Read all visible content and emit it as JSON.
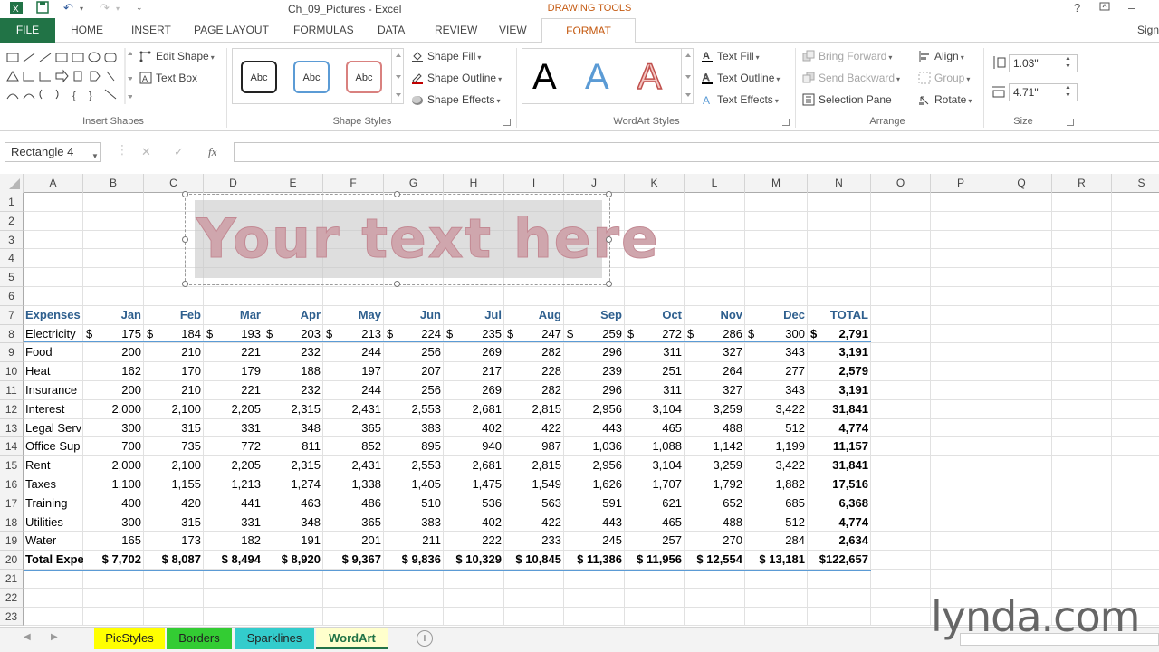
{
  "window": {
    "title": "Ch_09_Pictures - Excel",
    "context_tab_group": "DRAWING TOOLS",
    "sign_in": "Sign"
  },
  "tabs": [
    "FILE",
    "HOME",
    "INSERT",
    "PAGE LAYOUT",
    "FORMULAS",
    "DATA",
    "REVIEW",
    "VIEW",
    "FORMAT"
  ],
  "ribbon": {
    "insert_shapes": {
      "label": "Insert Shapes",
      "edit_shape": "Edit Shape",
      "text_box": "Text Box"
    },
    "shape_styles": {
      "label": "Shape Styles",
      "styles": [
        "Abc",
        "Abc",
        "Abc"
      ],
      "shape_fill": "Shape Fill",
      "shape_outline": "Shape Outline",
      "shape_effects": "Shape Effects"
    },
    "wordart_styles": {
      "label": "WordArt Styles",
      "letters": [
        "A",
        "A",
        "A"
      ],
      "text_fill": "Text Fill",
      "text_outline": "Text Outline",
      "text_effects": "Text Effects"
    },
    "arrange": {
      "label": "Arrange",
      "bring_forward": "Bring Forward",
      "send_backward": "Send Backward",
      "selection_pane": "Selection Pane",
      "align": "Align",
      "group": "Group",
      "rotate": "Rotate"
    },
    "size": {
      "label": "Size",
      "height": "1.03\"",
      "width": "4.71\""
    }
  },
  "formula_bar": {
    "name_box": "Rectangle 4",
    "fx": "fx",
    "value": ""
  },
  "columns": [
    "A",
    "B",
    "C",
    "D",
    "E",
    "F",
    "G",
    "H",
    "I",
    "J",
    "K",
    "L",
    "M",
    "N",
    "O",
    "P",
    "Q",
    "R",
    "S"
  ],
  "rows": [
    "1",
    "2",
    "3",
    "4",
    "5",
    "6",
    "7",
    "8",
    "9",
    "10",
    "11",
    "12",
    "13",
    "14",
    "15",
    "16",
    "17",
    "18",
    "19",
    "20",
    "21",
    "22",
    "23"
  ],
  "table": {
    "headers": [
      "Expenses",
      "Jan",
      "Feb",
      "Mar",
      "Apr",
      "May",
      "Jun",
      "Jul",
      "Aug",
      "Sep",
      "Oct",
      "Nov",
      "Dec",
      "TOTAL"
    ],
    "rows": [
      [
        "Electricity",
        "175",
        "184",
        "193",
        "203",
        "213",
        "224",
        "235",
        "247",
        "259",
        "272",
        "286",
        "300",
        "2,791"
      ],
      [
        "Food",
        "200",
        "210",
        "221",
        "232",
        "244",
        "256",
        "269",
        "282",
        "296",
        "311",
        "327",
        "343",
        "3,191"
      ],
      [
        "Heat",
        "162",
        "170",
        "179",
        "188",
        "197",
        "207",
        "217",
        "228",
        "239",
        "251",
        "264",
        "277",
        "2,579"
      ],
      [
        "Insurance",
        "200",
        "210",
        "221",
        "232",
        "244",
        "256",
        "269",
        "282",
        "296",
        "311",
        "327",
        "343",
        "3,191"
      ],
      [
        "Interest",
        "2,000",
        "2,100",
        "2,205",
        "2,315",
        "2,431",
        "2,553",
        "2,681",
        "2,815",
        "2,956",
        "3,104",
        "3,259",
        "3,422",
        "31,841"
      ],
      [
        "Legal Serv",
        "300",
        "315",
        "331",
        "348",
        "365",
        "383",
        "402",
        "422",
        "443",
        "465",
        "488",
        "512",
        "4,774"
      ],
      [
        "Office Sup",
        "700",
        "735",
        "772",
        "811",
        "852",
        "895",
        "940",
        "987",
        "1,036",
        "1,088",
        "1,142",
        "1,199",
        "11,157"
      ],
      [
        "Rent",
        "2,000",
        "2,100",
        "2,205",
        "2,315",
        "2,431",
        "2,553",
        "2,681",
        "2,815",
        "2,956",
        "3,104",
        "3,259",
        "3,422",
        "31,841"
      ],
      [
        "Taxes",
        "1,100",
        "1,155",
        "1,213",
        "1,274",
        "1,338",
        "1,405",
        "1,475",
        "1,549",
        "1,626",
        "1,707",
        "1,792",
        "1,882",
        "17,516"
      ],
      [
        "Training",
        "400",
        "420",
        "441",
        "463",
        "486",
        "510",
        "536",
        "563",
        "591",
        "621",
        "652",
        "685",
        "6,368"
      ],
      [
        "Utilities",
        "300",
        "315",
        "331",
        "348",
        "365",
        "383",
        "402",
        "422",
        "443",
        "465",
        "488",
        "512",
        "4,774"
      ],
      [
        "Water",
        "165",
        "173",
        "182",
        "191",
        "201",
        "211",
        "222",
        "233",
        "245",
        "257",
        "270",
        "284",
        "2,634"
      ]
    ],
    "total_row": [
      "Total Expe",
      "$ 7,702",
      "$ 8,087",
      "$ 8,494",
      "$ 8,920",
      "$ 9,367",
      "$ 9,836",
      "$ 10,329",
      "$ 10,845",
      "$ 11,386",
      "$ 11,956",
      "$ 12,554",
      "$ 13,181",
      "$122,657"
    ],
    "dollar_sign": "$"
  },
  "wordart": {
    "text": "Your text here"
  },
  "sheets": [
    {
      "name": "PicStyles",
      "color": "#ffff00"
    },
    {
      "name": "Borders",
      "color": "#33cc33"
    },
    {
      "name": "Sparklines",
      "color": "#33cccc"
    },
    {
      "name": "WordArt",
      "color": "#ffffcc",
      "active": true
    }
  ],
  "watermark": "lynda.com",
  "colors": {
    "excel_green": "#217346",
    "format_orange": "#c55a11",
    "header_blue": "#2e5f8e"
  }
}
